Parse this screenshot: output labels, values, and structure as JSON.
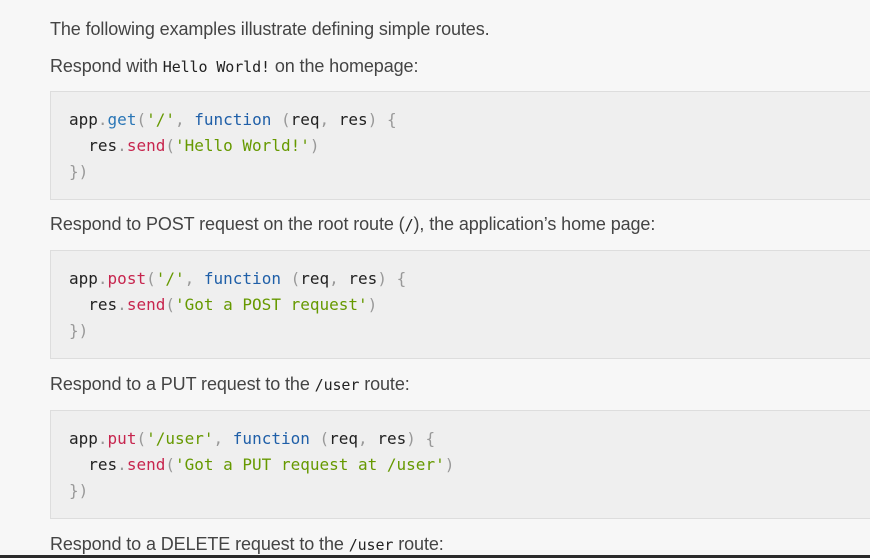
{
  "intro": "The following examples illustrate defining simple routes.",
  "examples": [
    {
      "desc_before": "Respond with ",
      "desc_code": "Hello World!",
      "desc_after": " on the homepage:",
      "code": {
        "obj": "app",
        "method": "get",
        "path": "'/'",
        "kw": "function",
        "param1": "req",
        "param2": "res",
        "inner_obj": "res",
        "inner_method": "send",
        "inner_str": "'Hello World!'"
      }
    },
    {
      "desc_before": "Respond to POST request on the root route (",
      "desc_code": "/",
      "desc_after": "), the application’s home page:",
      "code": {
        "obj": "app",
        "method": "post",
        "path": "'/'",
        "kw": "function",
        "param1": "req",
        "param2": "res",
        "inner_obj": "res",
        "inner_method": "send",
        "inner_str": "'Got a POST request'"
      }
    },
    {
      "desc_before": "Respond to a PUT request to the ",
      "desc_code": "/user",
      "desc_after": " route:",
      "code": {
        "obj": "app",
        "method": "put",
        "path": "'/user'",
        "kw": "function",
        "param1": "req",
        "param2": "res",
        "inner_obj": "res",
        "inner_method": "send",
        "inner_str": "'Got a PUT request at /user'"
      }
    },
    {
      "desc_before": "Respond to a DELETE request to the ",
      "desc_code": "/user",
      "desc_after": " route:"
    }
  ]
}
